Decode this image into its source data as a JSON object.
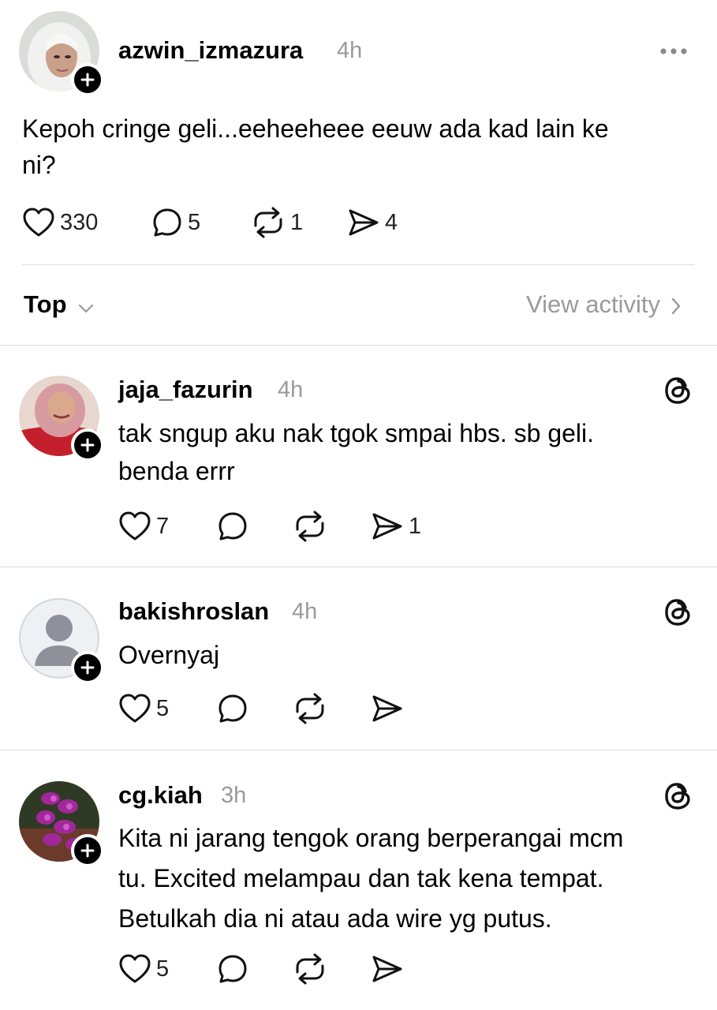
{
  "post": {
    "username": "azwin_izmazura",
    "time": "4h",
    "text_line1": "Kepoh cringe geli...eeheeheee eeuw ada kad lain ke",
    "text_line2": "ni?",
    "likes": "330",
    "replies": "5",
    "reposts": "1",
    "shares": "4",
    "icons": [
      "more-icon",
      "heart-icon",
      "comment-icon",
      "repost-icon",
      "share-icon",
      "follow-plus-icon"
    ]
  },
  "sort": {
    "label": "Top",
    "view_activity": "View activity"
  },
  "replies": [
    {
      "username": "jaja_fazurin",
      "time": "4h",
      "line1": "tak sngup aku nak tgok smpai hbs. sb geli.",
      "line2": "benda errr",
      "likes": "7",
      "replies": "",
      "reposts": "",
      "shares": "1"
    },
    {
      "username": "bakishroslan",
      "time": "4h",
      "line1": "Overnyaj",
      "likes": "5",
      "replies": "",
      "reposts": "",
      "shares": ""
    },
    {
      "username": "cg.kiah",
      "time": "3h",
      "line1": "Kita ni jarang tengok orang berperangai mcm",
      "line2": "tu. Excited melampau dan tak kena tempat.",
      "line3": "Betulkah dia ni atau ada wire yg putus.",
      "likes": "5",
      "replies": "",
      "reposts": "",
      "shares": ""
    }
  ],
  "colors": {
    "text": "#000000",
    "muted": "#999999",
    "divider": "#dedede",
    "badge": "#000000"
  }
}
